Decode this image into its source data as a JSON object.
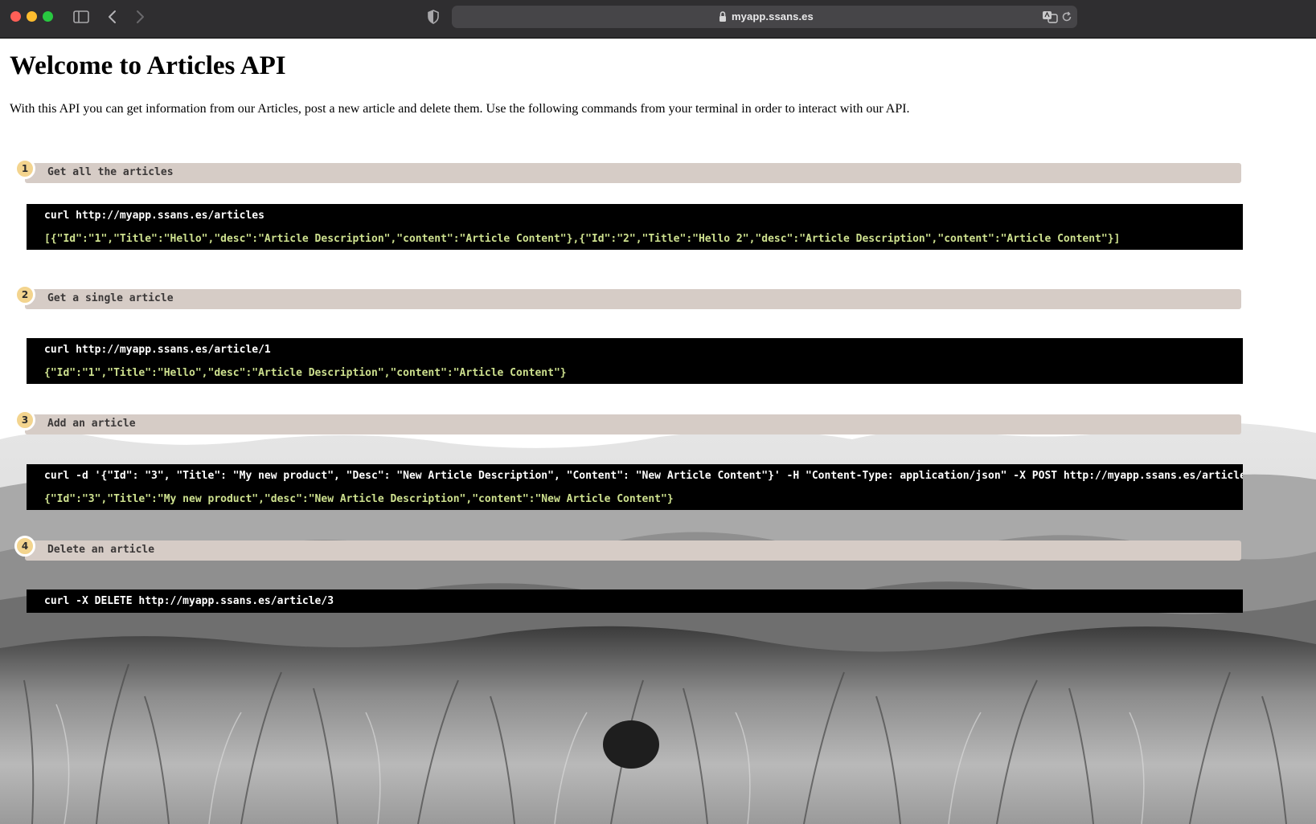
{
  "browser": {
    "url": "myapp.ssans.es"
  },
  "page": {
    "title": "Welcome to Articles API",
    "intro": "With this API you can get information from our Articles, post a new article and delete them. Use the following commands from your terminal in order to interact with our API."
  },
  "steps": [
    {
      "number": "1",
      "label": "Get all the articles",
      "command": "curl http://myapp.ssans.es/articles",
      "response": "[{\"Id\":\"1\",\"Title\":\"Hello\",\"desc\":\"Article Description\",\"content\":\"Article Content\"},{\"Id\":\"2\",\"Title\":\"Hello 2\",\"desc\":\"Article Description\",\"content\":\"Article Content\"}]"
    },
    {
      "number": "2",
      "label": "Get a single article",
      "command": "curl http://myapp.ssans.es/article/1",
      "response": "{\"Id\":\"1\",\"Title\":\"Hello\",\"desc\":\"Article Description\",\"content\":\"Article Content\"}"
    },
    {
      "number": "3",
      "label": "Add an article",
      "command": "curl -d '{\"Id\": \"3\", \"Title\": \"My new product\", \"Desc\": \"New Article Description\", \"Content\": \"New Article Content\"}' -H \"Content-Type: application/json\" -X POST http://myapp.ssans.es/article",
      "response": "{\"Id\":\"3\",\"Title\":\"My new product\",\"desc\":\"New Article Description\",\"content\":\"New Article Content\"}"
    },
    {
      "number": "4",
      "label": "Delete an article",
      "command": "curl -X DELETE http://myapp.ssans.es/article/3"
    }
  ],
  "colors": {
    "chrome": "#2f2e30",
    "address_bar": "#464548",
    "step_header": "#d6ccc6",
    "step_badge": "#f3d48e",
    "code_bg": "#000000",
    "code_string": "#cde08e"
  },
  "icons": [
    "sidebar-icon",
    "back-icon",
    "forward-icon",
    "shield-icon",
    "lock-icon",
    "translate-icon",
    "reload-icon"
  ]
}
